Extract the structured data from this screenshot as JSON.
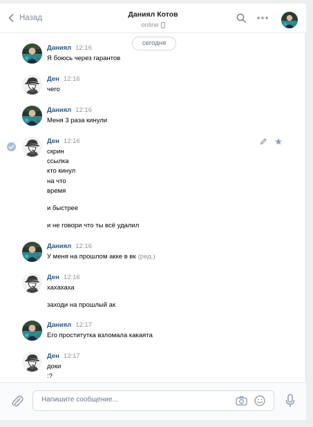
{
  "header": {
    "back_label": "Назад",
    "title": "Даниял Котов",
    "status": "online"
  },
  "date_divider": "сегодня",
  "messages": [
    {
      "name": "Даниял",
      "time": "12:16",
      "avatar": "daniyal",
      "lines": [
        "Я боюсь через гарантов"
      ]
    },
    {
      "name": "Ден",
      "time": "12:16",
      "avatar": "den",
      "lines": [
        "чего"
      ]
    },
    {
      "name": "Даниял",
      "time": "12:16",
      "avatar": "daniyal",
      "lines": [
        "Меня 3 раза кинули"
      ]
    },
    {
      "name": "Ден",
      "time": "12:16",
      "avatar": "den",
      "selected": true,
      "lines": [
        "скрин",
        "ссылка",
        "кто кинул",
        "на что",
        "время",
        "",
        "и быстрее",
        "",
        "и не говори что ты всё удалил"
      ]
    },
    {
      "name": "Даниял",
      "time": "12:16",
      "avatar": "daniyal",
      "lines": [
        "У меня на прошлом акке в вк"
      ],
      "edited_label": "(ред.)"
    },
    {
      "name": "Ден",
      "time": "12:16",
      "avatar": "den",
      "lines": [
        "хахахаха",
        "",
        "заходи на прошлый ак"
      ]
    },
    {
      "name": "Даниял",
      "time": "12:17",
      "avatar": "daniyal",
      "lines": [
        "Его проститутка взломала какаята"
      ]
    },
    {
      "name": "Ден",
      "time": "12:17",
      "avatar": "den",
      "lines": [
        "доки",
        ":?"
      ]
    }
  ],
  "composer": {
    "placeholder": "Напишите сообщение..."
  },
  "icons": {
    "back": "chevron-left-icon",
    "search": "search-icon",
    "more": "more-icon",
    "phone": "mobile-phone-icon",
    "check": "check-circle-icon",
    "edit": "pencil-icon",
    "favorite": "star-icon",
    "attach": "paperclip-icon",
    "camera": "camera-icon",
    "emoji": "smile-icon",
    "voice": "microphone-icon"
  },
  "colors": {
    "name": "#2a5885",
    "meta": "#939393",
    "background": "#edeef0",
    "accent": "#5181b8"
  }
}
